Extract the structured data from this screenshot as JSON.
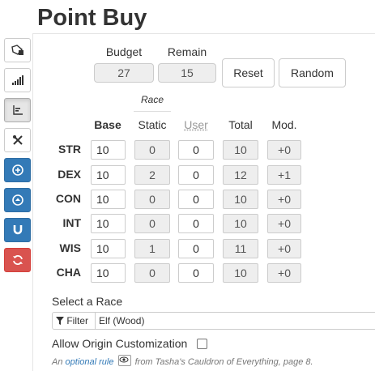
{
  "header": {
    "title": "Point Buy"
  },
  "sidebar": {
    "buttons": [
      {
        "name": "dice-tag-icon",
        "style": "plain"
      },
      {
        "name": "signal-bars-icon",
        "style": "plain"
      },
      {
        "name": "chart-icon",
        "style": "active"
      },
      {
        "name": "tools-icon",
        "style": "plain"
      },
      {
        "name": "plus-circle-icon",
        "style": "blue"
      },
      {
        "name": "up-circle-icon",
        "style": "blue"
      },
      {
        "name": "magnet-icon",
        "style": "blue"
      },
      {
        "name": "refresh-icon",
        "style": "red"
      }
    ]
  },
  "budget": {
    "label": "Budget",
    "value": "27"
  },
  "remain": {
    "label": "Remain",
    "value": "15"
  },
  "buttons": {
    "reset": "Reset",
    "random": "Random"
  },
  "table": {
    "race_header": "Race",
    "columns": {
      "base": "Base",
      "static": "Static",
      "user": "User",
      "total": "Total",
      "mod": "Mod."
    },
    "rows": [
      {
        "label": "STR",
        "base": "10",
        "static": "0",
        "user": "0",
        "total": "10",
        "mod": "+0"
      },
      {
        "label": "DEX",
        "base": "10",
        "static": "2",
        "user": "0",
        "total": "12",
        "mod": "+1"
      },
      {
        "label": "CON",
        "base": "10",
        "static": "0",
        "user": "0",
        "total": "10",
        "mod": "+0"
      },
      {
        "label": "INT",
        "base": "10",
        "static": "0",
        "user": "0",
        "total": "10",
        "mod": "+0"
      },
      {
        "label": "WIS",
        "base": "10",
        "static": "1",
        "user": "0",
        "total": "11",
        "mod": "+0"
      },
      {
        "label": "CHA",
        "base": "10",
        "static": "0",
        "user": "0",
        "total": "10",
        "mod": "+0"
      }
    ]
  },
  "race": {
    "label": "Select a Race",
    "filter_label": "Filter",
    "value": "Elf (Wood)"
  },
  "origin": {
    "label": "Allow Origin Customization",
    "note_prefix": "An",
    "note_link": "optional rule",
    "note_suffix": "from Tasha's Cauldron of Everything, page 8."
  },
  "colors": {
    "blue": "#337ab7",
    "red": "#d9534f",
    "link": "#337ab7"
  }
}
